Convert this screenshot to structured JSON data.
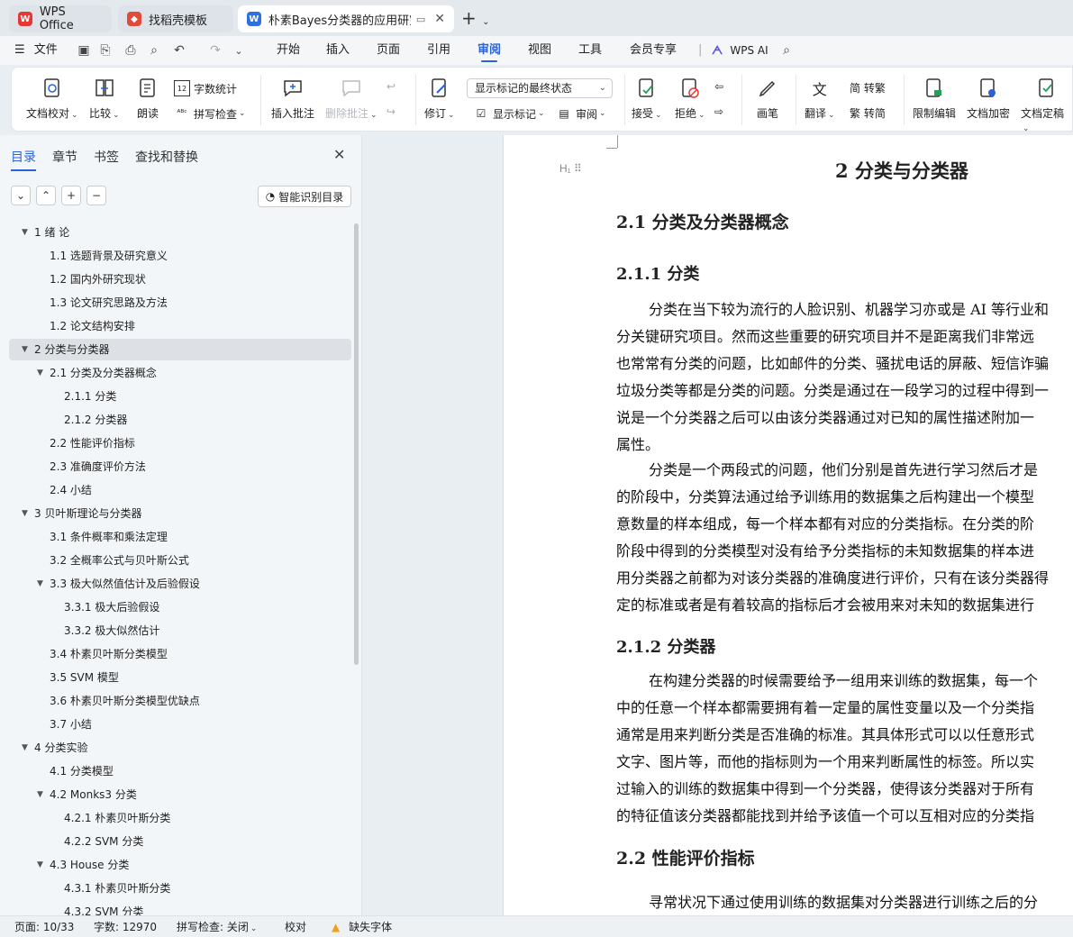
{
  "tabs": [
    {
      "label": "WPS Office"
    },
    {
      "label": "找稻壳模板"
    },
    {
      "label": "朴素Bayes分类器的应用研究与"
    }
  ],
  "menu": {
    "file": "文件",
    "items": [
      "开始",
      "插入",
      "页面",
      "引用",
      "审阅",
      "视图",
      "工具",
      "会员专享"
    ],
    "active": "审阅",
    "wps_ai": "WPS AI"
  },
  "ribbon": {
    "doc_check": "文档校对",
    "compare": "比较",
    "read_aloud": "朗读",
    "word_count": "字数统计",
    "spell_check": "拼写检查",
    "insert_comment": "插入批注",
    "delete_comment": "删除批注",
    "revise": "修订",
    "markup_select": "显示标记的最终状态",
    "show_markup": "显示标记",
    "review_pane": "审阅",
    "accept": "接受",
    "reject": "拒绝",
    "pen": "画笔",
    "translate": "翻译",
    "to_traditional": "简 转繁",
    "to_simplified": "繁 转简",
    "restrict_edit": "限制编辑",
    "encrypt": "文档加密",
    "finalize": "文档定稿"
  },
  "nav": {
    "tabs": [
      "目录",
      "章节",
      "书签",
      "查找和替换"
    ],
    "smart_toc": "智能识别目录",
    "toc": [
      {
        "text": "1  绪  论",
        "level": 0,
        "expanded": true
      },
      {
        "text": "1.1  选题背景及研究意义",
        "level": 1
      },
      {
        "text": "1.2  国内外研究现状",
        "level": 1
      },
      {
        "text": "1.3  论文研究思路及方法",
        "level": 1
      },
      {
        "text": "1.2  论文结构安排",
        "level": 1
      },
      {
        "text": "2 分类与分类器",
        "level": 0,
        "expanded": true,
        "selected": true
      },
      {
        "text": "2.1  分类及分类器概念",
        "level": 1,
        "expanded": true
      },
      {
        "text": "2.1.1  分类",
        "level": 2
      },
      {
        "text": "2.1.2  分类器",
        "level": 2
      },
      {
        "text": "2.2  性能评价指标",
        "level": 1
      },
      {
        "text": "2.3  准确度评价方法",
        "level": 1
      },
      {
        "text": "2.4  小结",
        "level": 1
      },
      {
        "text": "3 贝叶斯理论与分类器",
        "level": 0,
        "expanded": true
      },
      {
        "text": "3.1  条件概率和乘法定理",
        "level": 1
      },
      {
        "text": "3.2  全概率公式与贝叶斯公式",
        "level": 1
      },
      {
        "text": "3.3  极大似然值估计及后验假设",
        "level": 1,
        "expanded": true
      },
      {
        "text": "3.3.1  极大后验假设",
        "level": 2
      },
      {
        "text": "3.3.2  极大似然估计",
        "level": 2
      },
      {
        "text": "3.4  朴素贝叶斯分类模型",
        "level": 1
      },
      {
        "text": "3.5 SVM 模型",
        "level": 1
      },
      {
        "text": "3.6 朴素贝叶斯分类模型优缺点",
        "level": 1
      },
      {
        "text": "3.7  小结",
        "level": 1
      },
      {
        "text": "4  分类实验",
        "level": 0,
        "expanded": true
      },
      {
        "text": "4.1 分类模型",
        "level": 1
      },
      {
        "text": "4.2 Monks3 分类",
        "level": 1,
        "expanded": true
      },
      {
        "text": "4.2.1  朴素贝叶斯分类",
        "level": 2
      },
      {
        "text": "4.2.2 SVM 分类",
        "level": 2
      },
      {
        "text": "4.3 House 分类",
        "level": 1,
        "expanded": true
      },
      {
        "text": "4.3.1  朴素贝叶斯分类",
        "level": 2
      },
      {
        "text": "4.3.2 SVM 分类",
        "level": 2
      }
    ]
  },
  "doc": {
    "chapter_title": "2 分类与分类器",
    "h2_1": "2.1  分类及分类器概念",
    "h3_1": "2.1.1  分类",
    "p1": [
      "分类在当下较为流行的人脸识别、机器学习亦或是 AI 等行业和",
      "分关键研究项目。然而这些重要的研究项目并不是距离我们非常远",
      "也常常有分类的问题，比如邮件的分类、骚扰电话的屏蔽、短信诈骗",
      "垃圾分类等都是分类的问题。分类是通过在一段学习的过程中得到一",
      "说是一个分类器之后可以由该分类器通过对已知的属性描述附加一",
      "属性。"
    ],
    "p2": [
      "分类是一个两段式的问题，他们分别是首先进行学习然后才是",
      "的阶段中，分类算法通过给予训练用的数据集之后构建出一个模型",
      "意数量的样本组成，每一个样本都有对应的分类指标。在分类的阶",
      "阶段中得到的分类模型对没有给予分类指标的未知数据集的样本进",
      "用分类器之前都为对该分类器的准确度进行评价，只有在该分类器得",
      "定的标准或者是有着较高的指标后才会被用来对未知的数据集进行"
    ],
    "h3_2": "2.1.2  分类器",
    "p3": [
      "在构建分类器的时候需要给予一组用来训练的数据集，每一个",
      "中的任意一个样本都需要拥有着一定量的属性变量以及一个分类指",
      "通常是用来判断分类是否准确的标准。其具体形式可以以任意形式",
      "文字、图片等，而他的指标则为一个用来判断属性的标签。所以实",
      "过输入的训练的数据集中得到一个分类器，使得该分类器对于所有",
      "的特征值该分类器都能找到并给予该值一个可以互相对应的分类指"
    ],
    "h2_2": "2.2  性能评价指标",
    "p4": [
      "寻常状况下通过使用训练的数据集对分类器进行训练之后的分"
    ]
  },
  "status": {
    "page": "页面: 10/33",
    "words": "字数: 12970",
    "spell": "拼写检查: 关闭",
    "proof": "校对",
    "missing_font": "缺失字体"
  },
  "colors": {
    "accent": "#2a63d8",
    "wps_red": "#e53935",
    "doc_blue": "#2f6fde",
    "warning": "#f0a020"
  }
}
